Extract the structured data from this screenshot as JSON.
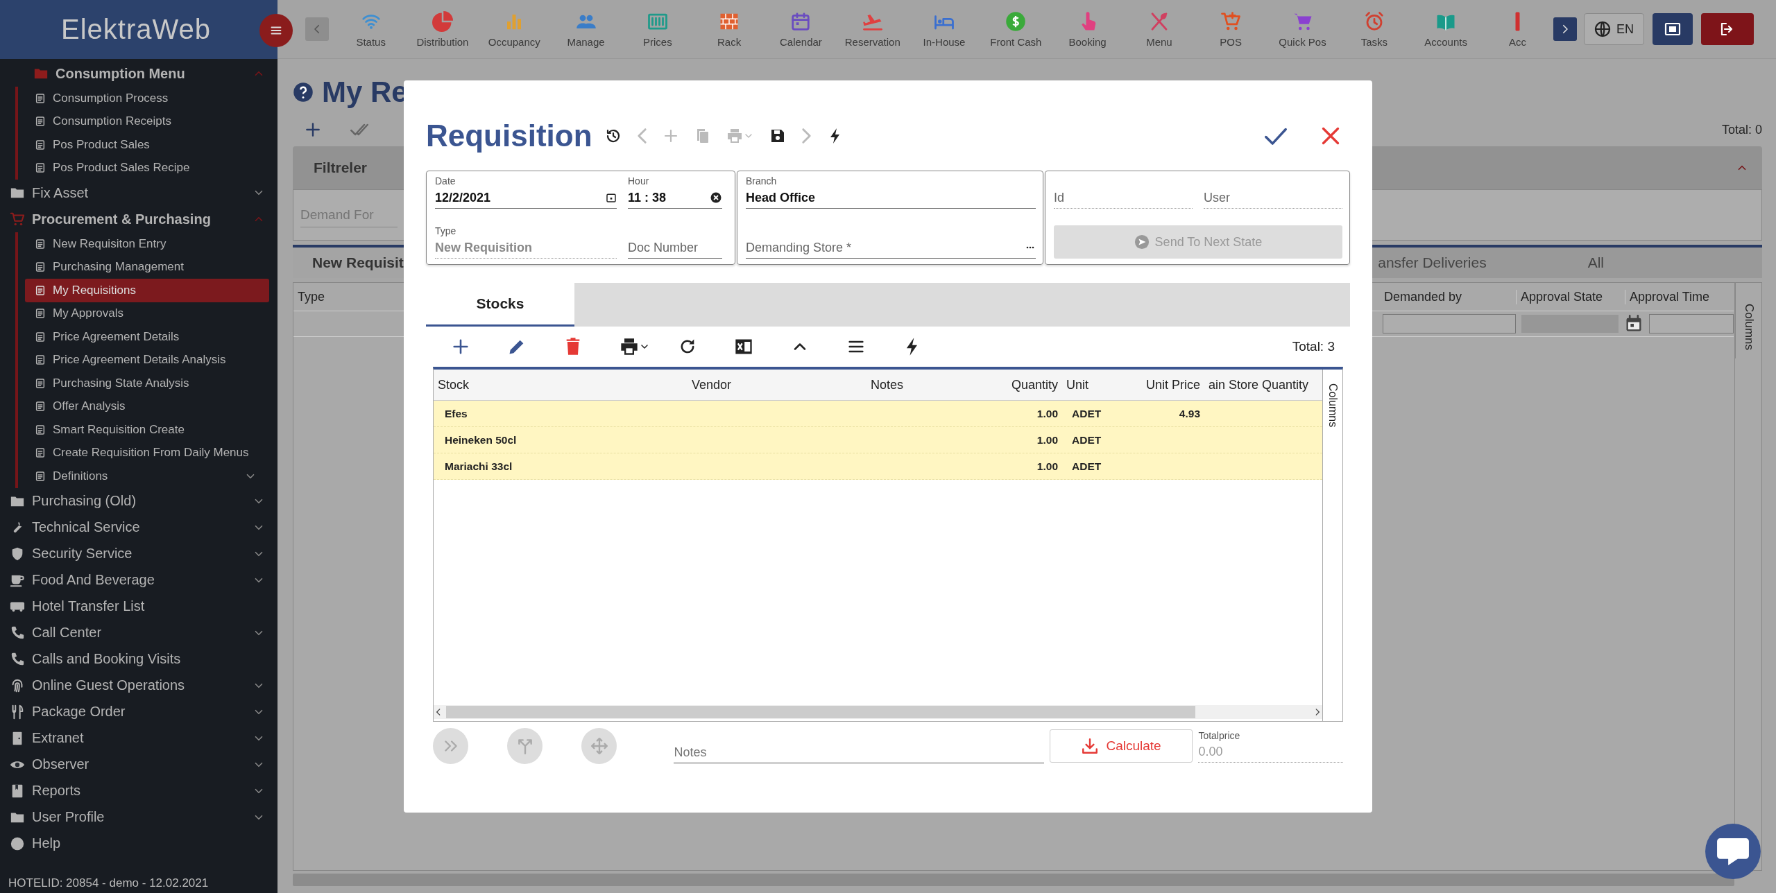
{
  "top_bar": {
    "logo": "ElektraWeb",
    "modules": [
      {
        "label": "Status",
        "color": "#3d8fd2"
      },
      {
        "label": "Distribution",
        "color": "#d23a3a"
      },
      {
        "label": "Occupancy",
        "color": "#e0a030"
      },
      {
        "label": "Manage",
        "color": "#3a7dc8"
      },
      {
        "label": "Prices",
        "color": "#1f9a8a"
      },
      {
        "label": "Rack",
        "color": "#e06030"
      },
      {
        "label": "Calendar",
        "color": "#6a4cc0"
      },
      {
        "label": "Reservation",
        "color": "#e04040"
      },
      {
        "label": "In-House",
        "color": "#3a6fd0"
      },
      {
        "label": "Front Cash",
        "color": "#3aaa3a"
      },
      {
        "label": "Booking",
        "color": "#e04080"
      },
      {
        "label": "Menu",
        "color": "#d04060"
      },
      {
        "label": "POS",
        "color": "#e05020"
      },
      {
        "label": "Quick Pos",
        "color": "#8a40d0"
      },
      {
        "label": "Tasks",
        "color": "#d04030"
      },
      {
        "label": "Accounts",
        "color": "#1a9a8a"
      },
      {
        "label": "Acc",
        "color": "#d03030"
      }
    ],
    "language": "EN"
  },
  "sidebar": {
    "items": [
      {
        "label": "Consumption Menu",
        "kind": "group",
        "expanded": true,
        "selected": false,
        "children": [
          {
            "label": "Consumption Process",
            "kind": "link",
            "selected": false
          },
          {
            "label": "Consumption Receipts",
            "kind": "link",
            "selected": false
          },
          {
            "label": "Pos Product Sales",
            "kind": "link",
            "selected": false
          },
          {
            "label": "Pos Product Sales Recipe",
            "kind": "link",
            "selected": false
          }
        ]
      },
      {
        "label": "Fix Asset",
        "kind": "group",
        "expanded": false,
        "selected": false
      },
      {
        "label": "Procurement & Purchasing",
        "kind": "group",
        "expanded": true,
        "selected": false,
        "children": [
          {
            "label": "New Requisiton Entry",
            "kind": "link",
            "selected": false
          },
          {
            "label": "Purchasing Management",
            "kind": "link",
            "selected": false
          },
          {
            "label": "My Requisitions",
            "kind": "link",
            "selected": true
          },
          {
            "label": "My Approvals",
            "kind": "link",
            "selected": false
          },
          {
            "label": "Price Agreement Details",
            "kind": "link",
            "selected": false
          },
          {
            "label": "Price Agreement Details Analysis",
            "kind": "link",
            "selected": false
          },
          {
            "label": "Purchasing State Analysis",
            "kind": "link",
            "selected": false
          },
          {
            "label": "Offer Analysis",
            "kind": "link",
            "selected": false
          },
          {
            "label": "Smart Requisition Create",
            "kind": "link",
            "selected": false
          },
          {
            "label": "Create Requisition From Daily Menus",
            "kind": "link",
            "selected": false
          },
          {
            "label": "Definitions",
            "kind": "group",
            "expanded": false,
            "selected": false
          }
        ]
      },
      {
        "label": "Purchasing (Old)",
        "kind": "group",
        "expanded": false,
        "selected": false
      },
      {
        "label": "Technical Service",
        "kind": "group",
        "expanded": false,
        "selected": false
      },
      {
        "label": "Security Service",
        "kind": "group",
        "expanded": false,
        "selected": false
      },
      {
        "label": "Food And Beverage",
        "kind": "group",
        "expanded": false,
        "selected": false
      },
      {
        "label": "Hotel Transfer List",
        "kind": "link",
        "selected": false
      },
      {
        "label": "Call Center",
        "kind": "group",
        "expanded": false,
        "selected": false
      },
      {
        "label": "Calls and Booking Visits",
        "kind": "link",
        "selected": false
      },
      {
        "label": "Online Guest Operations",
        "kind": "group",
        "expanded": false,
        "selected": false
      },
      {
        "label": "Package Order",
        "kind": "group",
        "expanded": false,
        "selected": false
      },
      {
        "label": "Extranet",
        "kind": "group",
        "expanded": false,
        "selected": false
      },
      {
        "label": "Observer",
        "kind": "group",
        "expanded": false,
        "selected": false
      },
      {
        "label": "Reports",
        "kind": "group",
        "expanded": false,
        "selected": false
      },
      {
        "label": "User Profile",
        "kind": "group",
        "expanded": false,
        "selected": false
      },
      {
        "label": "Help",
        "kind": "link",
        "selected": false
      }
    ],
    "footer": "HOTELID: 20854 - demo - 12.02.2021"
  },
  "page": {
    "title": "My Re",
    "total": "Total: 0",
    "filter_panel": {
      "title": "Filtreler",
      "expanded": true,
      "field": {
        "placeholder": "Demand For"
      }
    },
    "tabs": [
      {
        "label": "New Requisit",
        "selected": true
      },
      {
        "label": "ansfer Deliveries",
        "selected": false
      },
      {
        "label": "All",
        "selected": false
      }
    ],
    "columns": [
      "Type",
      "Demanded by",
      "Approval State",
      "Approval Time"
    ],
    "column_panel": "Columns"
  },
  "modal": {
    "title": "Requisition",
    "toolbar": [
      {
        "kind": "history",
        "disabled": false
      },
      {
        "kind": "back",
        "disabled": true
      },
      {
        "kind": "add",
        "disabled": true
      },
      {
        "kind": "copy",
        "disabled": true
      },
      {
        "kind": "print",
        "disabled": true
      },
      {
        "kind": "save",
        "disabled": false
      },
      {
        "kind": "forward",
        "disabled": true
      },
      {
        "kind": "bolt",
        "disabled": false
      }
    ],
    "form": {
      "date": {
        "label": "Date",
        "value": "12/2/2021"
      },
      "hour": {
        "label": "Hour",
        "value": "11 : 38"
      },
      "type": {
        "label": "Type",
        "value": "New Requisition"
      },
      "doc_number": {
        "placeholder": "Doc Number"
      },
      "branch": {
        "label": "Branch",
        "value": "Head Office"
      },
      "demanding_store": {
        "placeholder": "Demanding Store *"
      },
      "id": {
        "placeholder": "Id"
      },
      "user": {
        "placeholder": "User"
      },
      "send_button": {
        "label": "Send To Next State",
        "disabled": true
      }
    },
    "tabs": [
      {
        "label": "Stocks",
        "selected": true
      }
    ],
    "total": "Total: 3",
    "columns": [
      "Stock",
      "Vendor",
      "Notes",
      "Quantity",
      "Unit",
      "Unit Price",
      "ain Store Quantity"
    ],
    "rows": [
      {
        "stock": "Efes",
        "quantity": "1.00",
        "unit": "ADET",
        "unit_price": "4.93"
      },
      {
        "stock": "Heineken 50cl",
        "quantity": "1.00",
        "unit": "ADET"
      },
      {
        "stock": "Mariachi 33cl",
        "quantity": "1.00",
        "unit": "ADET"
      }
    ],
    "column_panel": "Columns",
    "notes": {
      "placeholder": "Notes"
    },
    "calculate_button": "Calculate",
    "total_price": {
      "label": "Totalprice",
      "value": "0.00"
    }
  }
}
